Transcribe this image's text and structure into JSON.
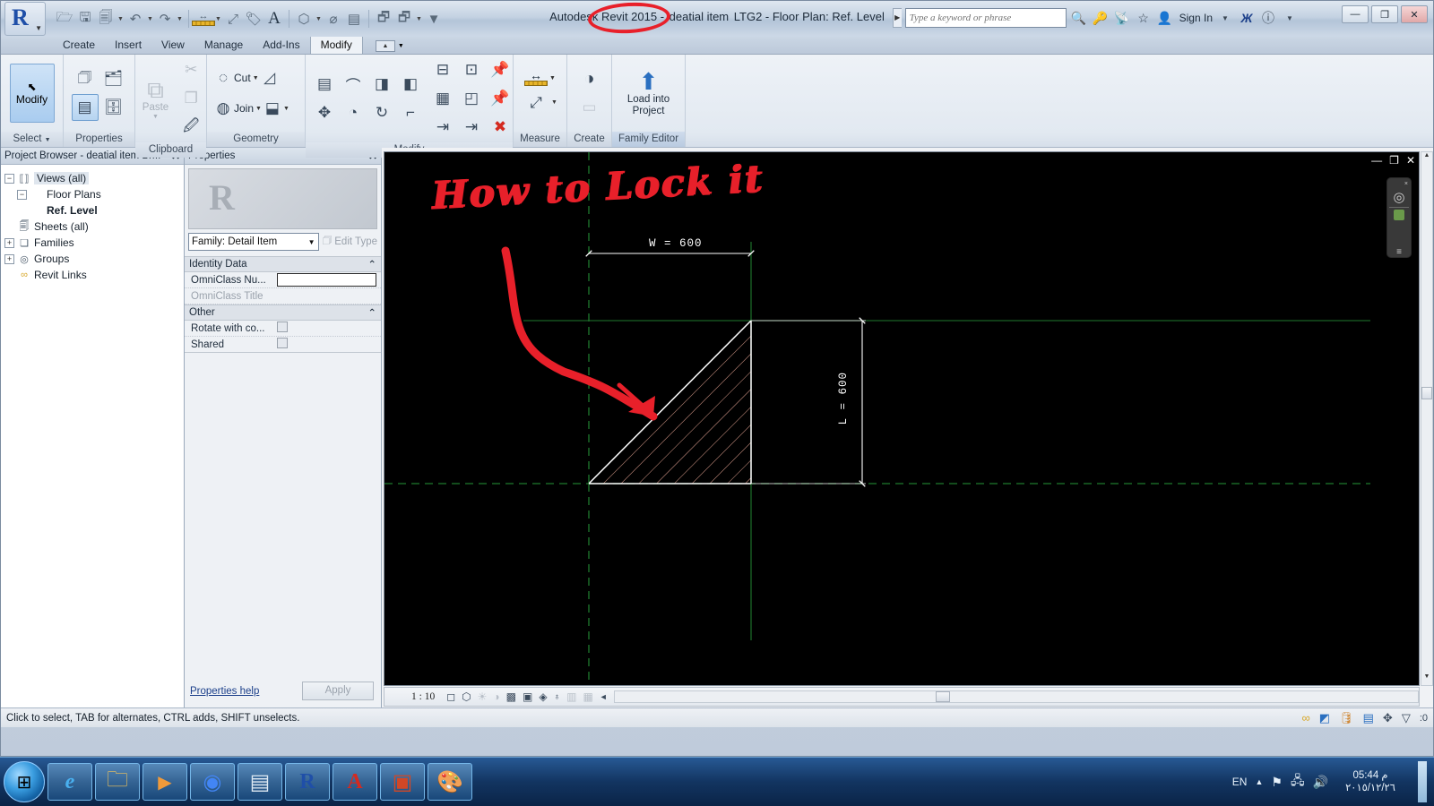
{
  "window": {
    "app_title_prefix": "Autodesk Revit 2015 - ",
    "annotated_name": "deatial item",
    "title_suffix": " LTG2 - Floor Plan: Ref. Level",
    "minimize": "—",
    "restore": "❐",
    "close": "✕"
  },
  "quick_access": {
    "items": [
      {
        "name": "open-icon",
        "glyph": "🗁"
      },
      {
        "name": "save-icon",
        "glyph": "🖫"
      },
      {
        "name": "save-as-icon",
        "glyph": "🖫"
      },
      {
        "name": "undo-icon",
        "glyph": "↶"
      },
      {
        "name": "redo-icon",
        "glyph": "↷"
      },
      {
        "name": "measure-icon",
        "glyph": "↔"
      },
      {
        "name": "aligned-dimension-icon",
        "glyph": "⤢"
      },
      {
        "name": "tag-icon",
        "glyph": "🏷"
      },
      {
        "name": "text-icon",
        "glyph": "A"
      },
      {
        "name": "default-3d-view-icon",
        "glyph": "⬡"
      },
      {
        "name": "section-icon",
        "glyph": "⌀"
      },
      {
        "name": "thin-lines-icon",
        "glyph": "▤"
      },
      {
        "name": "close-hidden-windows-icon",
        "glyph": "🗗"
      },
      {
        "name": "switch-windows-icon",
        "glyph": "🗗"
      },
      {
        "name": "customize-qat-icon",
        "glyph": "▾"
      }
    ]
  },
  "search": {
    "placeholder": "Type a keyword or phrase",
    "expand_arrow": "▶",
    "icons": [
      {
        "name": "search-icon",
        "glyph": "🔍"
      },
      {
        "name": "subscription-key-icon",
        "glyph": "🔑"
      },
      {
        "name": "communication-center-icon",
        "glyph": "📡"
      },
      {
        "name": "favorites-star-icon",
        "glyph": "☆"
      },
      {
        "name": "user-account-icon",
        "glyph": "👤"
      }
    ],
    "sign_in": "Sign In",
    "sign_in_caret": "▾",
    "exchange_icon": "X",
    "help_icon": "?",
    "help_caret": "▾"
  },
  "tabs": {
    "items": [
      {
        "label": "Create",
        "active": false
      },
      {
        "label": "Insert",
        "active": false
      },
      {
        "label": "View",
        "active": false
      },
      {
        "label": "Manage",
        "active": false
      },
      {
        "label": "Add-Ins",
        "active": false
      },
      {
        "label": "Modify",
        "active": true
      }
    ],
    "options_glyph": "▱",
    "options_caret": "▾"
  },
  "ribbon": {
    "groups": [
      {
        "title": "Select",
        "caret": "▾",
        "big_button": {
          "label": "Modify",
          "icon": "cursor-arrow-icon",
          "glyph": "⬉"
        }
      },
      {
        "title": "Properties",
        "buttons": [
          {
            "name": "type-properties-icon",
            "glyph": "🗇"
          },
          {
            "name": "family-category-icon",
            "glyph": "🗂"
          },
          {
            "name": "family-types-icon",
            "glyph": "🗄"
          },
          {
            "name": "properties-panel-icon",
            "glyph": "▤"
          }
        ]
      },
      {
        "title": "Clipboard",
        "paste_label": "Paste",
        "paste_caret": "▾",
        "buttons": [
          {
            "name": "copy-icon",
            "glyph": "⧉"
          },
          {
            "name": "cut-icon",
            "glyph": "✂"
          },
          {
            "name": "duplicate-icon",
            "glyph": "❐"
          },
          {
            "name": "match-type-icon",
            "glyph": "🖌"
          }
        ]
      },
      {
        "title": "Geometry",
        "cut_label": "Cut",
        "join_label": "Join",
        "caret": "▾",
        "extra_icons": [
          {
            "name": "cut-geometry-icon",
            "glyph": "◳"
          },
          {
            "name": "join-geometry-icon",
            "glyph": "⬓"
          }
        ]
      },
      {
        "title": "Modify",
        "buttons": [
          {
            "name": "align-icon",
            "glyph": "▤"
          },
          {
            "name": "offset-icon",
            "glyph": "⌒"
          },
          {
            "name": "mirror-pick-axis-icon",
            "glyph": "◨"
          },
          {
            "name": "mirror-draw-axis-icon",
            "glyph": "◨"
          },
          {
            "name": "move-icon",
            "glyph": "✥"
          },
          {
            "name": "copy-move-icon",
            "glyph": "◔"
          },
          {
            "name": "rotate-icon",
            "glyph": "↻"
          },
          {
            "name": "trim-extend-corner-icon",
            "glyph": "⌐"
          },
          {
            "name": "split-element-icon",
            "glyph": "⊟"
          },
          {
            "name": "array-icon",
            "glyph": "▦"
          },
          {
            "name": "unpin-icon",
            "glyph": "📌"
          },
          {
            "name": "scale-icon",
            "glyph": "◰"
          },
          {
            "name": "pin-icon",
            "glyph": "📌"
          },
          {
            "name": "trim-single-icon",
            "glyph": "⇥"
          },
          {
            "name": "trim-multiple-icon",
            "glyph": "⇥"
          },
          {
            "name": "delete-icon",
            "glyph": "✕"
          }
        ]
      },
      {
        "title": "Measure",
        "buttons": [
          {
            "name": "measure-between-references-icon",
            "glyph": "↔"
          },
          {
            "name": "measure-along-element-icon",
            "glyph": "⤢"
          }
        ],
        "caret": "▾"
      },
      {
        "title": "Create",
        "buttons": [
          {
            "name": "create-group-icon",
            "glyph": "◑"
          },
          {
            "name": "create-similar-icon",
            "glyph": "▭"
          }
        ]
      },
      {
        "title": "Family Editor",
        "big_button": {
          "label_line1": "Load into",
          "label_line2": "Project",
          "icon": "load-into-project-icon",
          "glyph": "⬆"
        }
      }
    ]
  },
  "project_browser": {
    "title": "Project Browser - deatial item LT...",
    "close_glyph": "✕",
    "tree": [
      {
        "label": "Views (all)",
        "depth": 0,
        "toggle": "-",
        "icon": "views-icon",
        "glyph": "⬚",
        "bold": false,
        "selected": true
      },
      {
        "label": "Floor Plans",
        "depth": 1,
        "toggle": "-",
        "icon": "folder-icon",
        "glyph": "",
        "bold": false,
        "selected": false
      },
      {
        "label": "Ref. Level",
        "depth": 2,
        "toggle": "",
        "icon": "view-icon",
        "glyph": "",
        "bold": true,
        "selected": false
      },
      {
        "label": "Sheets (all)",
        "depth": 0,
        "toggle": "",
        "icon": "sheets-icon",
        "glyph": "🗐",
        "bold": false,
        "selected": false
      },
      {
        "label": "Families",
        "depth": 0,
        "toggle": "+",
        "icon": "families-icon",
        "glyph": "❏",
        "bold": false,
        "selected": false
      },
      {
        "label": "Groups",
        "depth": 0,
        "toggle": "+",
        "icon": "groups-icon",
        "glyph": "◎",
        "bold": false,
        "selected": false
      },
      {
        "label": "Revit Links",
        "depth": 0,
        "toggle": "",
        "icon": "revit-links-icon",
        "glyph": "⛓",
        "bold": false,
        "selected": false
      }
    ]
  },
  "properties": {
    "title": "Properties",
    "close_glyph": "✕",
    "type_selector": "Family: Detail Item",
    "type_selector_caret": "▼",
    "edit_type_label": "Edit Type",
    "edit_type_icon": "edit-type-icon",
    "sections": [
      {
        "name": "Identity Data",
        "collapse_glyph": "⌃",
        "rows": [
          {
            "name": "OmniClass Nu...",
            "value": "",
            "kind": "text",
            "dim": false
          },
          {
            "name": "OmniClass Title",
            "value": "",
            "kind": "readonly",
            "dim": true
          }
        ]
      },
      {
        "name": "Other",
        "collapse_glyph": "⌃",
        "rows": [
          {
            "name": "Rotate with co...",
            "value": "",
            "kind": "checkbox",
            "dim": false
          },
          {
            "name": "Shared",
            "value": "",
            "kind": "checkbox",
            "dim": false
          }
        ]
      }
    ],
    "help_link": "Properties help",
    "apply_button": "Apply"
  },
  "canvas": {
    "annotation_text": "How to Lock it",
    "annotation_color": "#e8202a",
    "dimension_width_label": "W = 600",
    "dimension_length_label": "L = 600",
    "background_color": "#000000",
    "reference_plane_color": "#1f7a2e",
    "geometry_color": "#ffffff",
    "hatch_color": "#e0a090",
    "view_buttons": [
      {
        "name": "view-minimize-button",
        "glyph": "—"
      },
      {
        "name": "view-restore-button",
        "glyph": "❐"
      },
      {
        "name": "view-close-button",
        "glyph": "✕"
      }
    ],
    "navigation_bar": {
      "close_glyph": "×",
      "steering_wheel_icon": "steering-wheel-icon",
      "pan_icon": "pan-icon",
      "menu_glyph": "≡"
    }
  },
  "view_control_bar": {
    "scale": "1 : 10",
    "icons": [
      {
        "name": "detail-level-icon",
        "glyph": "◻"
      },
      {
        "name": "visual-style-icon",
        "glyph": "⬡"
      },
      {
        "name": "sun-path-icon",
        "glyph": "☀"
      },
      {
        "name": "shadows-icon",
        "glyph": "◑"
      },
      {
        "name": "render-icon",
        "glyph": "▦"
      },
      {
        "name": "crop-view-icon",
        "glyph": "▣"
      },
      {
        "name": "show-crop-region-icon",
        "glyph": "◈"
      },
      {
        "name": "temporary-hide-isolate-icon",
        "glyph": "♁"
      },
      {
        "name": "reveal-hidden-elements-icon",
        "glyph": "▩"
      },
      {
        "name": "analytical-model-icon",
        "glyph": "▩"
      }
    ],
    "collapse_glyph": "◄"
  },
  "status_bar": {
    "message": "Click to select, TAB for alternates, CTRL adds, SHIFT unselects.",
    "right_icons": [
      {
        "name": "worksets-icon",
        "glyph": "⛓"
      },
      {
        "name": "design-options-icon",
        "glyph": "◩"
      },
      {
        "name": "editing-request-icon",
        "glyph": "🛢"
      },
      {
        "name": "exclude-options-icon",
        "glyph": "▤"
      },
      {
        "name": "select-links-icon",
        "glyph": "✥"
      },
      {
        "name": "filter-icon",
        "glyph": "▽"
      }
    ],
    "filter_count": ":0"
  },
  "taskbar": {
    "start_glyph": "⊞",
    "buttons": [
      {
        "name": "taskbar-internet-explorer",
        "glyph": "ℯ",
        "color": "#1a78c2"
      },
      {
        "name": "taskbar-file-explorer",
        "glyph": "🗀",
        "color": "#e8b84b"
      },
      {
        "name": "taskbar-media-player",
        "glyph": "▶",
        "color": "#e88a2a"
      },
      {
        "name": "taskbar-google-chrome",
        "glyph": "◉",
        "color": "#4285f4"
      },
      {
        "name": "taskbar-notepad",
        "glyph": "▤",
        "color": "#dbe6f0"
      },
      {
        "name": "taskbar-revit",
        "glyph": "R",
        "color": "#1f4fa8"
      },
      {
        "name": "taskbar-adobe-acrobat",
        "glyph": "A",
        "color": "#d42a20"
      },
      {
        "name": "taskbar-powerpoint",
        "glyph": "▣",
        "color": "#d24726"
      },
      {
        "name": "taskbar-paint",
        "glyph": "🎨",
        "color": "#4aa3d8"
      }
    ],
    "tray": {
      "language": "EN",
      "expand_glyph": "▲",
      "icons": [
        {
          "name": "action-center-icon",
          "glyph": "⚑"
        },
        {
          "name": "network-icon",
          "glyph": "🖧"
        },
        {
          "name": "volume-icon",
          "glyph": "🔊"
        }
      ],
      "time": "05:44 م",
      "date": "٢٠١٥/١٢/٢٦"
    }
  }
}
